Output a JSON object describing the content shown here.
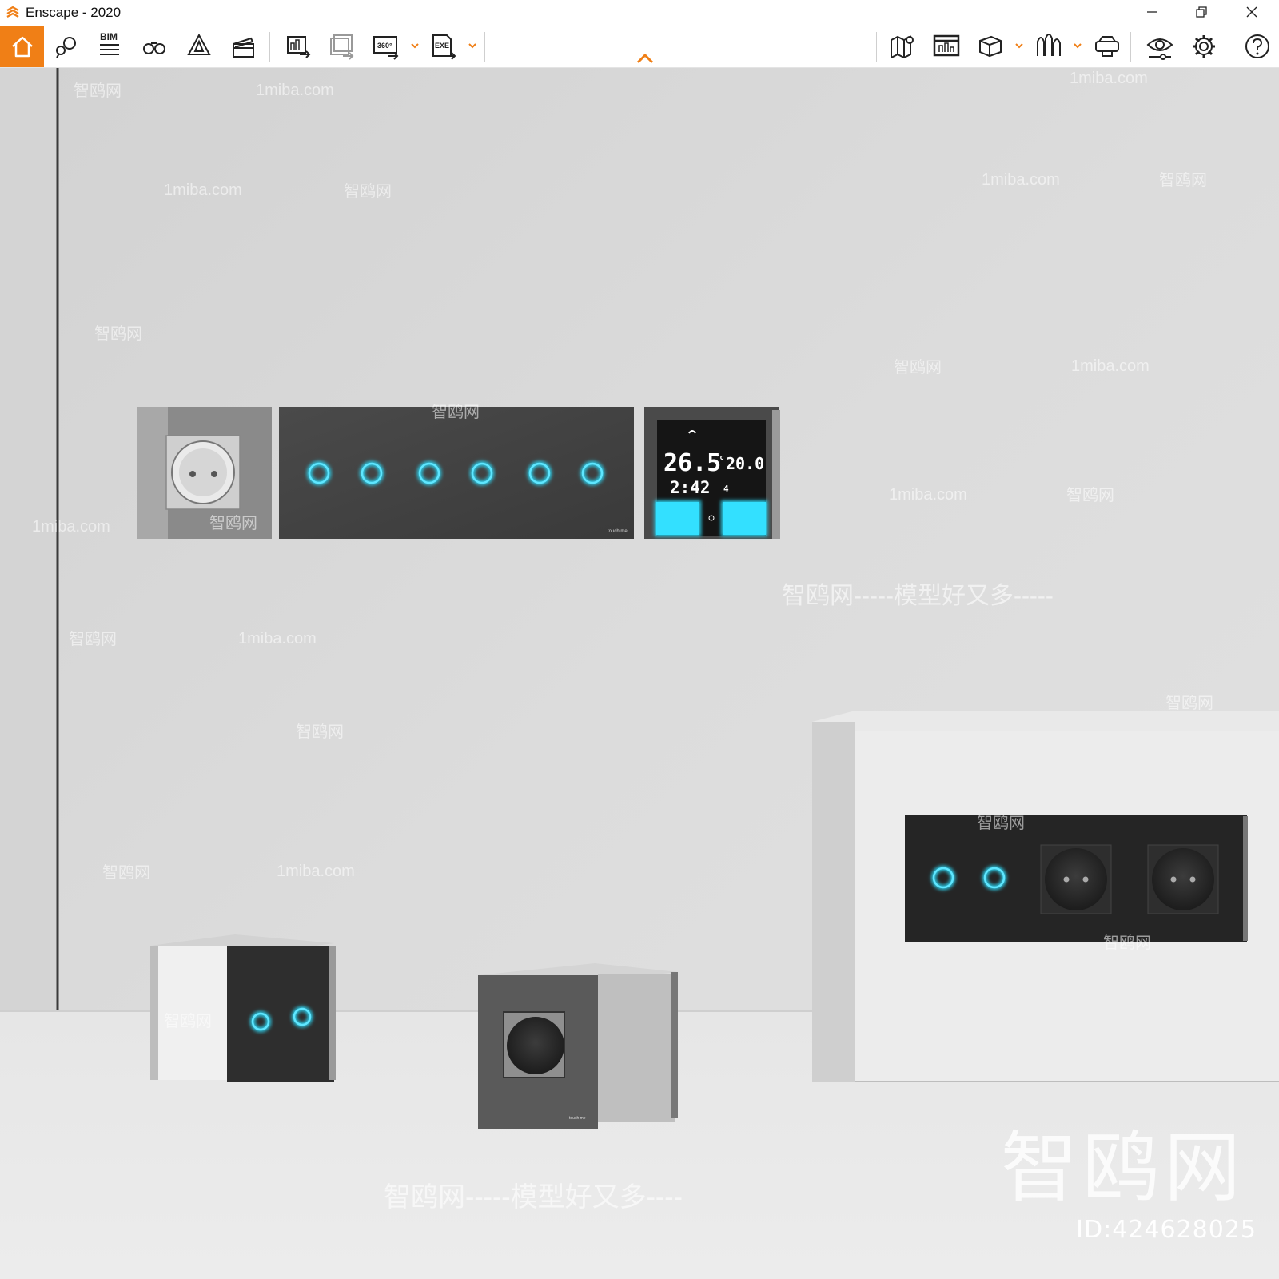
{
  "window": {
    "title": "Enscape - 2020",
    "controls": {
      "minimize": "minimize",
      "restore": "restore",
      "close": "close"
    }
  },
  "toolbar": {
    "left_icons": [
      "home-icon",
      "light-view-icon",
      "bim-icon",
      "binoculars-icon",
      "bell-perspective-icon",
      "clapperboard-icon"
    ],
    "bim_label": "BIM",
    "export_icons": [
      "screenshot-export-icon",
      "batch-export-icon",
      "panorama-360-icon",
      "exe-export-icon"
    ],
    "panorama_label": "360°",
    "exe_label": "EXE",
    "right_icons": [
      "map-icon",
      "web-standalone-icon",
      "box-view-icon",
      "asset-library-icon",
      "vr-headset-icon",
      "visual-settings-icon",
      "settings-gear-icon",
      "help-icon"
    ],
    "accent_color": "#f07f16"
  },
  "scene": {
    "thermostat": {
      "temp_current": "26.5",
      "temp_unit": "°c",
      "temp_target": "20.0",
      "time": "2:42",
      "fan_level": "4"
    },
    "brand_label": "touch me",
    "glow_color": "#2bd3f0"
  },
  "watermarks": {
    "site": "1miba.com",
    "brand": "智鸥网",
    "slogan": "智鸥网-----模型好又多-----",
    "footer_slogan": "智鸥网-----模型好又多----",
    "big_logo": "智鸥网",
    "id": "ID:424628025"
  }
}
